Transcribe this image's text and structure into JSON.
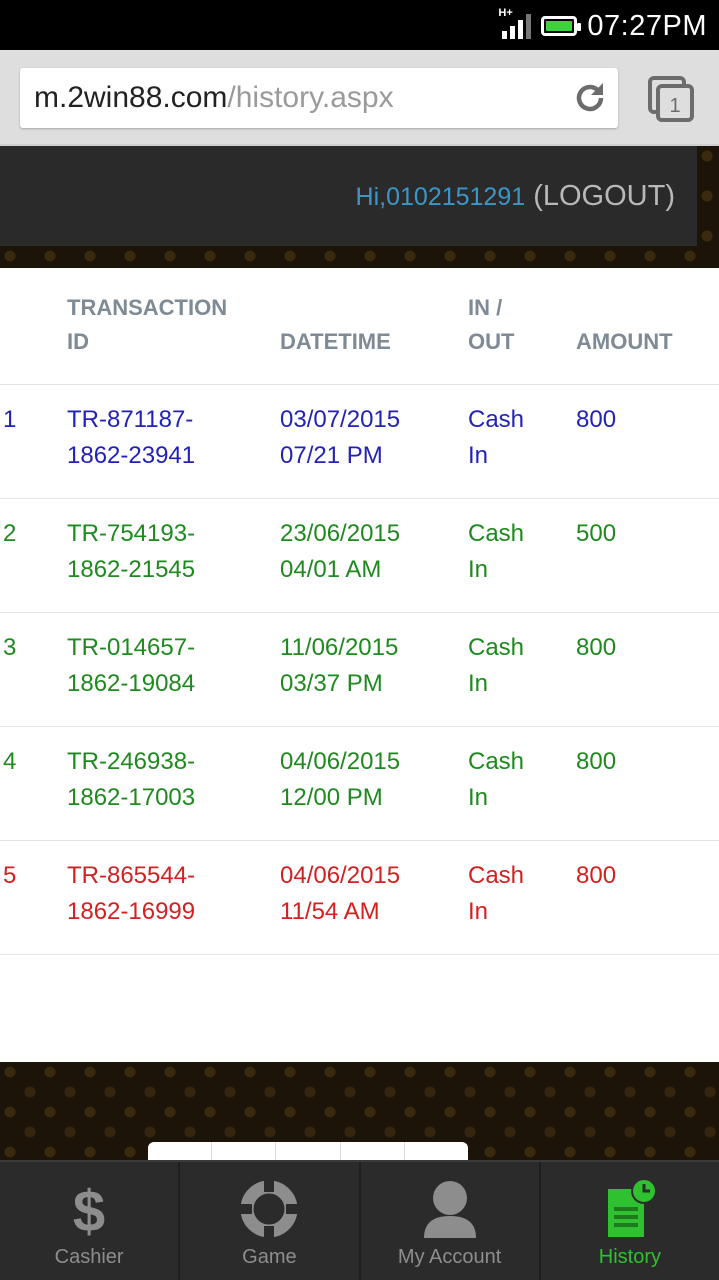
{
  "status_bar": {
    "network": "H+",
    "time": "07:27PM",
    "battery_color": "#3cd43c"
  },
  "browser": {
    "url_host": "m.2win88.com",
    "url_path": "/history.aspx",
    "tab_count": "1"
  },
  "header": {
    "greeting": "Hi,0102151291",
    "logout_open": " (",
    "logout_label": "LOGOUT",
    "logout_close": ")"
  },
  "table": {
    "headers": {
      "id_line1": "TRANSACTION",
      "id_line2": "ID",
      "datetime": "DATETIME",
      "inout_line1": "IN /",
      "inout_line2": "OUT",
      "amount": "AMOUNT"
    },
    "rows": [
      {
        "no": "1",
        "id1": "TR-871187-",
        "id2": "1862-23941",
        "date": "03/07/2015",
        "time": "07/21 PM",
        "io1": "Cash",
        "io2": "In",
        "amount": "800",
        "color": "#2222b8"
      },
      {
        "no": "2",
        "id1": "TR-754193-",
        "id2": "1862-21545",
        "date": "23/06/2015",
        "time": "04/01 AM",
        "io1": "Cash",
        "io2": "In",
        "amount": "500",
        "color": "#1e8a1e"
      },
      {
        "no": "3",
        "id1": "TR-014657-",
        "id2": "1862-19084",
        "date": "11/06/2015",
        "time": "03/37 PM",
        "io1": "Cash",
        "io2": "In",
        "amount": "800",
        "color": "#1e8a1e"
      },
      {
        "no": "4",
        "id1": "TR-246938-",
        "id2": "1862-17003",
        "date": "04/06/2015",
        "time": "12/00 PM",
        "io1": "Cash",
        "io2": "In",
        "amount": "800",
        "color": "#1e8a1e"
      },
      {
        "no": "5",
        "id1": "TR-865544-",
        "id2": "1862-16999",
        "date": "04/06/2015",
        "time": "11/54 AM",
        "io1": "Cash",
        "io2": "In",
        "amount": "800",
        "color": "#d42020"
      }
    ]
  },
  "nav": {
    "items": [
      {
        "label": "Cashier",
        "icon": "dollar-icon"
      },
      {
        "label": "Game",
        "icon": "game-icon"
      },
      {
        "label": "My Account",
        "icon": "user-icon"
      },
      {
        "label": "History",
        "icon": "history-icon"
      }
    ],
    "active_color": "#2fc12f"
  }
}
